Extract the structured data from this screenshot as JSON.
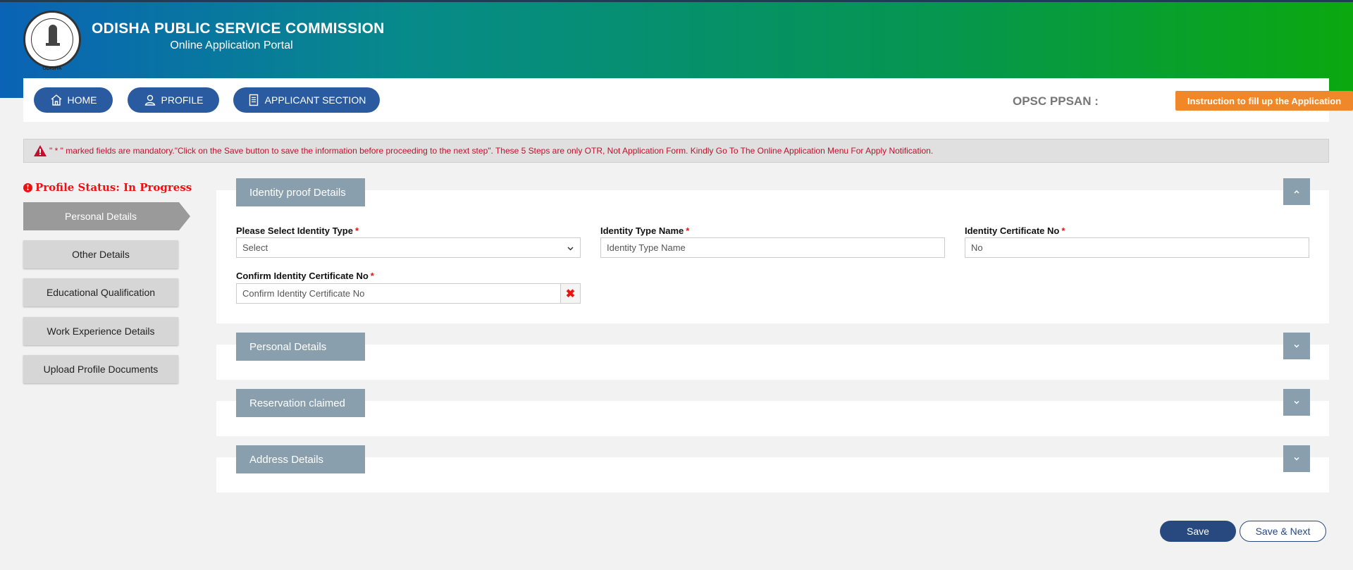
{
  "header": {
    "title": "ODISHA PUBLIC SERVICE COMMISSION",
    "subtitle": "Online Application Portal",
    "logo_text": "ODISHA"
  },
  "nav": {
    "home": "HOME",
    "profile": "PROFILE",
    "applicant_section": "APPLICANT SECTION",
    "ppsan_label": "OPSC PPSAN :",
    "instruction_button": "Instruction to fill up the Application"
  },
  "alert": {
    "text": "\" * \" marked fields are mandatory.\"Click on the Save button to save the information before proceeding to the next step\". These 5 Steps are only OTR, Not Application Form. Kindly Go To The Online Application Menu For Apply Notification."
  },
  "sidebar": {
    "status": "Profile Status: In Progress",
    "items": [
      {
        "label": "Personal Details",
        "active": true
      },
      {
        "label": "Other Details",
        "active": false
      },
      {
        "label": "Educational Qualification",
        "active": false
      },
      {
        "label": "Work Experience Details",
        "active": false
      },
      {
        "label": "Upload Profile Documents",
        "active": false
      }
    ]
  },
  "panels": {
    "identity": {
      "title": "Identity proof Details",
      "identity_type_label": "Please Select Identity Type",
      "identity_type_value": "Select",
      "type_name_label": "Identity Type Name",
      "type_name_placeholder": "Identity Type Name",
      "cert_no_label": "Identity Certificate No",
      "cert_no_placeholder": "No",
      "confirm_label": "Confirm Identity Certificate No",
      "confirm_placeholder": "Confirm Identity Certificate No",
      "required_mark": "*"
    },
    "personal": {
      "title": "Personal Details"
    },
    "reservation": {
      "title": "Reservation claimed"
    },
    "address": {
      "title": "Address Details"
    }
  },
  "footer": {
    "save": "Save",
    "save_next": "Save & Next"
  },
  "colors": {
    "nav_button": "#2a5ba0",
    "instruction": "#f0882a",
    "panel_head": "#8a9fae",
    "alert_text": "#c0102c"
  }
}
